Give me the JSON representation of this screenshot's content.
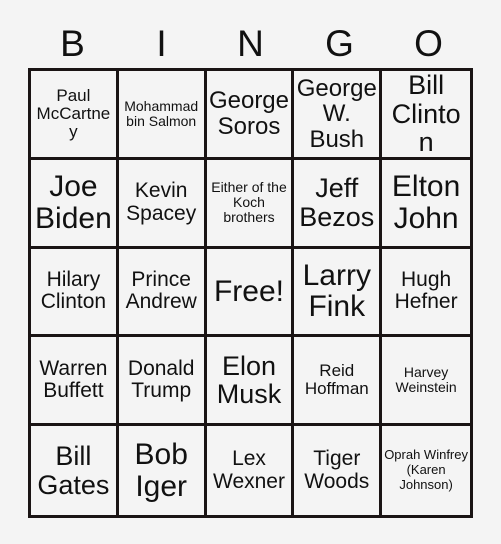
{
  "card": {
    "title": "BINGO",
    "headers": [
      "B",
      "I",
      "N",
      "G",
      "O"
    ],
    "rows": [
      [
        {
          "label": "Paul McCartney",
          "size": "sm"
        },
        {
          "label": "Mohammad bin Salmon",
          "size": "xs"
        },
        {
          "label": "George Soros",
          "size": "lg"
        },
        {
          "label": "George W. Bush",
          "size": "lg"
        },
        {
          "label": "Bill Clinton",
          "size": "xl"
        }
      ],
      [
        {
          "label": "Joe Biden",
          "size": "xxl"
        },
        {
          "label": "Kevin Spacey",
          "size": "md"
        },
        {
          "label": "Either of the Koch brothers",
          "size": "xs"
        },
        {
          "label": "Jeff Bezos",
          "size": "xl"
        },
        {
          "label": "Elton John",
          "size": "xxl"
        }
      ],
      [
        {
          "label": "Hilary Clinton",
          "size": "md"
        },
        {
          "label": "Prince Andrew",
          "size": "md"
        },
        {
          "label": "Free!",
          "size": "xxl"
        },
        {
          "label": "Larry Fink",
          "size": "xxl"
        },
        {
          "label": "Hugh Hefner",
          "size": "md"
        }
      ],
      [
        {
          "label": "Warren Buffett",
          "size": "md"
        },
        {
          "label": "Donald Trump",
          "size": "md"
        },
        {
          "label": "Elon Musk",
          "size": "xl"
        },
        {
          "label": "Reid Hoffman",
          "size": "sm"
        },
        {
          "label": "Harvey Weinstein",
          "size": "xs"
        }
      ],
      [
        {
          "label": "Bill Gates",
          "size": "xl"
        },
        {
          "label": "Bob Iger",
          "size": "xxl"
        },
        {
          "label": "Lex Wexner",
          "size": "md"
        },
        {
          "label": "Tiger Woods",
          "size": "md"
        },
        {
          "label": "Oprah Winfrey (Karen Johnson)",
          "size": "xxs"
        }
      ]
    ],
    "colors": {
      "background": "#f4f4f4",
      "grid_line": "#1a1414",
      "text": "#111111"
    }
  }
}
